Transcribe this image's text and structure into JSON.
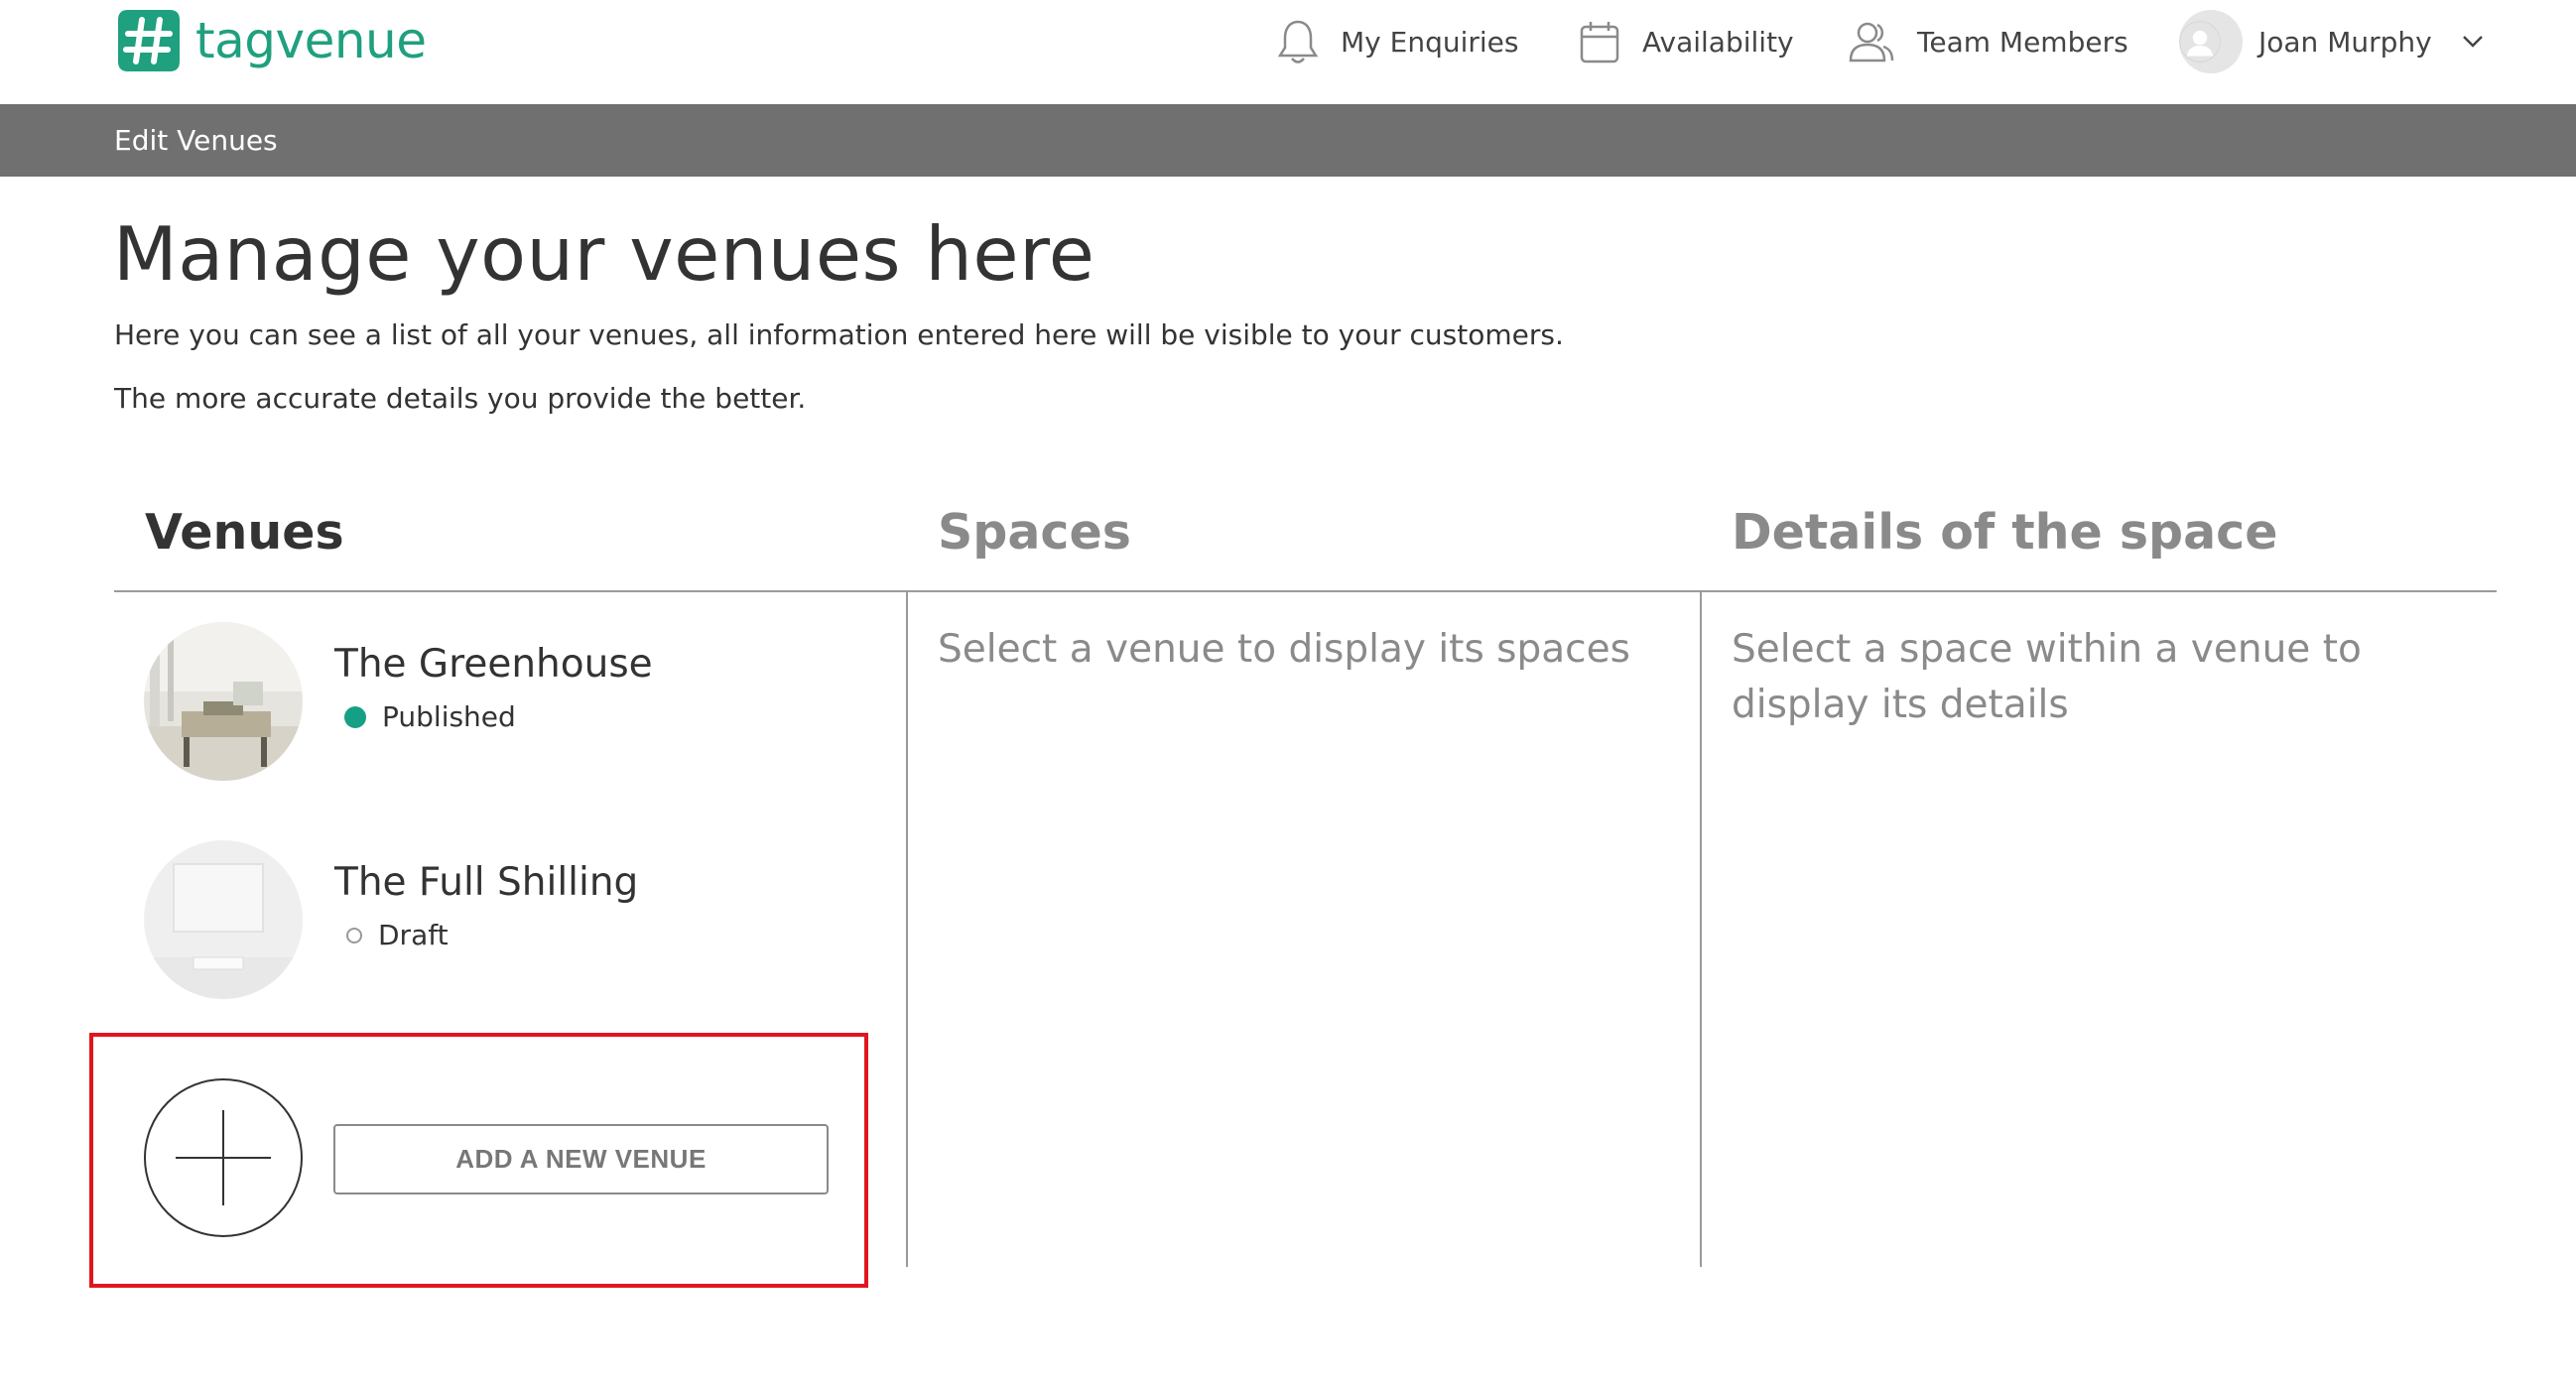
{
  "brand": {
    "name": "tagvenue",
    "color": "#1fa07f"
  },
  "nav": {
    "enquiries": {
      "label": "My Enquiries",
      "icon": "bell-icon"
    },
    "availability": {
      "label": "Availability",
      "icon": "calendar-icon"
    },
    "team": {
      "label": "Team Members",
      "icon": "team-icon"
    },
    "user": {
      "name": "Joan Murphy",
      "icon": "chevron-down-icon"
    }
  },
  "subnav": {
    "label": "Edit Venues"
  },
  "main": {
    "title": "Manage your venues here",
    "description_1": "Here you can see a list of all your venues, all information entered here will be visible to your customers.",
    "description_2": "The more accurate details you provide the better."
  },
  "columns": {
    "venues": "Venues",
    "spaces": "Spaces",
    "details": "Details of the space"
  },
  "venues": [
    {
      "name": "The Greenhouse",
      "status": "Published",
      "status_color": "#15a085"
    },
    {
      "name": "The Full Shilling",
      "status": "Draft"
    }
  ],
  "add_venue": {
    "label": "ADD A NEW VENUE"
  },
  "spaces_placeholder": "Select a venue to display its spaces",
  "details_placeholder": "Select a space within a venue to display its details",
  "highlight_color": "#e0161f"
}
